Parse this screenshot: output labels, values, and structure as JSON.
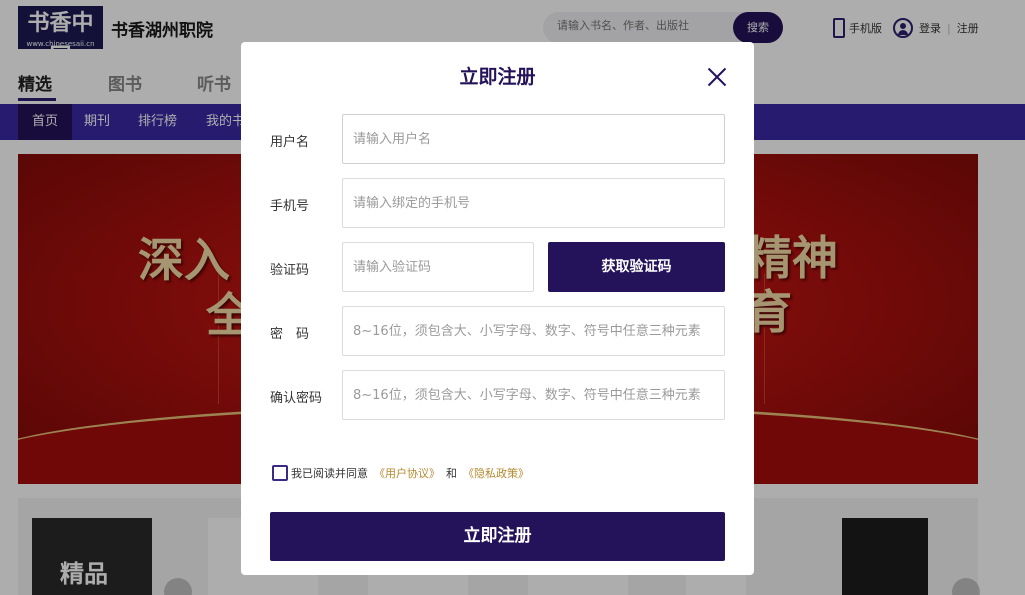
{
  "header": {
    "logo_text": "书香中国",
    "logo_url_text": "www.chinesesaii.cn",
    "org_name": "书香湖州职院",
    "search": {
      "placeholder": "请输入书名、作者、出版社",
      "button": "搜索"
    },
    "mobile_label": "手机版",
    "login_label": "登录",
    "separator": "|",
    "register_label": "注册"
  },
  "subnav": {
    "tabs": [
      "精选",
      "图书",
      "听书"
    ],
    "active": 0
  },
  "mainnav": {
    "items": [
      "首页",
      "期刊",
      "排行榜",
      "我的书"
    ],
    "active": 0
  },
  "banner": {
    "visible_text": [
      "深入",
      "全",
      "精神",
      "育"
    ]
  },
  "books_section": {
    "cover_text_1": "精品"
  },
  "modal": {
    "title": "立即注册",
    "fields": [
      {
        "label": "用户名",
        "placeholder": "请输入用户名",
        "value": ""
      },
      {
        "label": "手机号",
        "placeholder": "请输入绑定的手机号",
        "value": ""
      },
      {
        "label": "验证码",
        "placeholder": "请输入验证码",
        "value": ""
      },
      {
        "label": "密　码",
        "placeholder": "8~16位，须包含大、小写字母、数字、符号中任意三种元素",
        "value": ""
      },
      {
        "label": "确认密码",
        "placeholder": "8~16位，须包含大、小写字母、数字、符号中任意三种元素",
        "value": ""
      }
    ],
    "get_code_button": "获取验证码",
    "agreement": {
      "checked": false,
      "prefix": "我已阅读并同意",
      "user_agreement": "《用户协议》",
      "conjunction": "和",
      "privacy_policy": "《隐私政策》"
    },
    "submit_button": "立即注册"
  },
  "colors": {
    "primary": "#24135a",
    "nav": "#3a28a6",
    "link": "#b5892f",
    "banner_red": "#c8180f"
  }
}
